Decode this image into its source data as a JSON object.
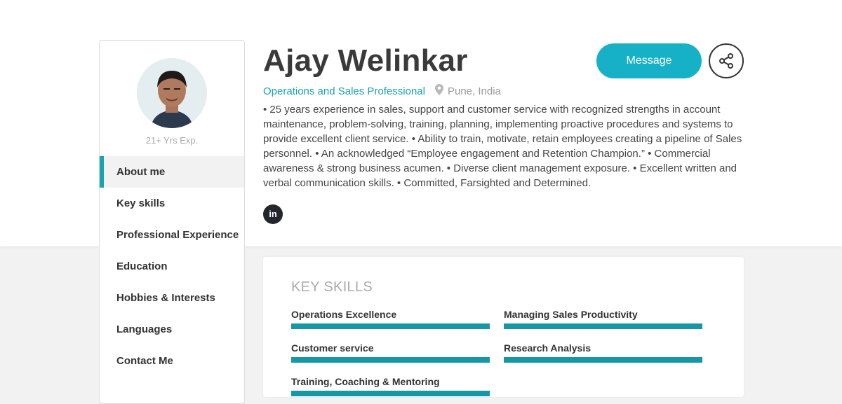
{
  "profile": {
    "name": "Ajay Welinkar",
    "title": "Operations and Sales Professional",
    "location": "Pune, India",
    "experience": "21+ Yrs Exp.",
    "bio": "• 25 years experience in sales, support and customer service with recognized strengths in account maintenance, problem-solving, training, planning, implementing proactive procedures and systems to provide excellent client service. • Ability to train, motivate, retain employees creating a pipeline of Sales personnel. • An acknowledged “Employee engagement and Retention Champion.” • Commercial awareness & strong business acumen. • Diverse client management exposure. • Excellent written and verbal communication skills. • Committed, Farsighted and Determined.",
    "linkedin_label": "in"
  },
  "actions": {
    "message_label": "Message",
    "share_icon": "share-icon"
  },
  "nav": {
    "items": [
      {
        "label": "About me",
        "active": true
      },
      {
        "label": "Key skills"
      },
      {
        "label": "Professional Experience"
      },
      {
        "label": "Education"
      },
      {
        "label": "Hobbies & Interests"
      },
      {
        "label": "Languages"
      },
      {
        "label": "Contact Me"
      }
    ]
  },
  "skills": {
    "heading": "KEY SKILLS",
    "items": [
      {
        "label": "Operations Excellence"
      },
      {
        "label": "Managing Sales Productivity"
      },
      {
        "label": "Customer service"
      },
      {
        "label": "Research Analysis"
      },
      {
        "label": "Training, Coaching & Mentoring"
      }
    ]
  },
  "colors": {
    "accent": "#17b1c7",
    "skill_bar": "#1697a5",
    "nav_active_marker": "#1aa3b0"
  }
}
